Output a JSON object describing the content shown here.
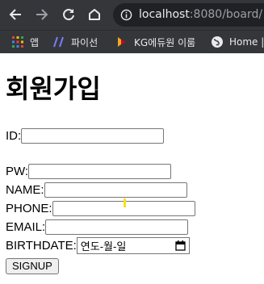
{
  "browser": {
    "url_host": "localhost",
    "url_rest": ":8080/board/",
    "bookmarks": [
      {
        "label": "앱",
        "icon": "apps-grid-icon"
      },
      {
        "label": "파이선",
        "icon": "slash-logo-icon"
      },
      {
        "label": "KG에듀원 이룸",
        "icon": "kg-logo-icon"
      },
      {
        "label": "Home |",
        "icon": "globe-icon"
      }
    ]
  },
  "form": {
    "title": "회원가입",
    "id_label": "ID:",
    "pw_label": "PW:",
    "name_label": "NAME:",
    "phone_label": "PHONE:",
    "email_label": "EMAIL:",
    "birthdate_label": "BIRTHDATE:",
    "birthdate_placeholder": "연도-월-일",
    "signup_label": "SIGNUP"
  }
}
